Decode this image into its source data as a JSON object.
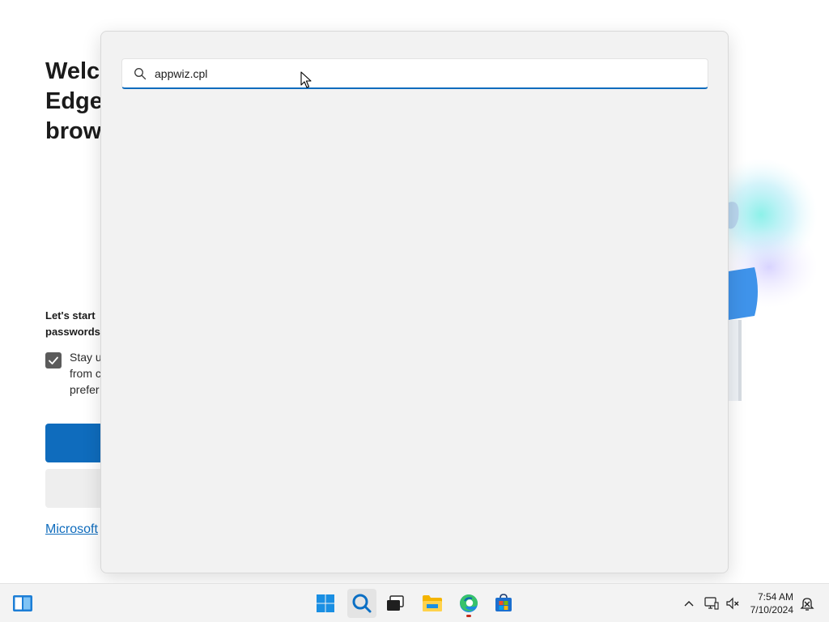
{
  "background_page": {
    "title_lines": [
      "Welco",
      "Edge,",
      "brows"
    ],
    "start_text_lines": [
      "Let's start",
      "passwords"
    ],
    "checkbox_text_lines": [
      "Stay u",
      "from c",
      "prefer"
    ],
    "link_text": "Microsoft"
  },
  "search_flyout": {
    "query": "appwiz.cpl"
  },
  "taskbar": {
    "clock": {
      "time": "7:54 AM",
      "date": "7/10/2024"
    },
    "apps": [
      "widgets-icon",
      "start-icon",
      "search-icon",
      "task-view-icon",
      "file-explorer-icon",
      "edge-icon",
      "store-icon"
    ],
    "tray": [
      "chevron-up-icon",
      "network-icon",
      "volume-icon",
      "notification-icon"
    ]
  },
  "colors": {
    "accent": "#0f6cbd",
    "flyout_bg": "#f2f2f2",
    "taskbar_bg": "#f3f3f3"
  }
}
